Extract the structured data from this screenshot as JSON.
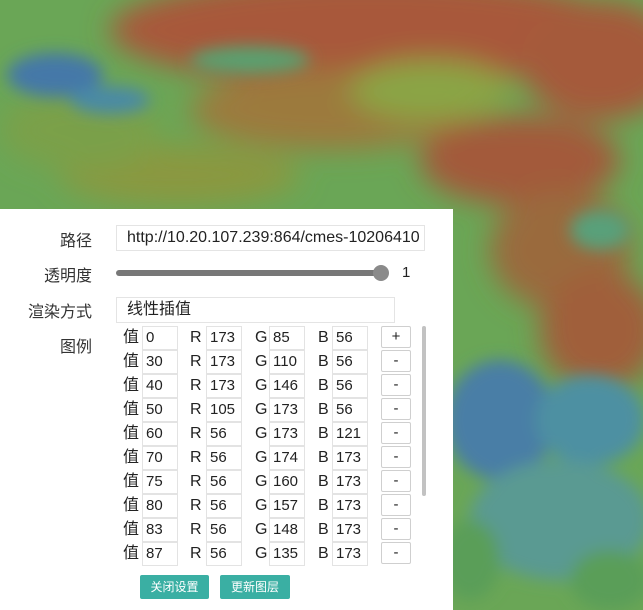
{
  "panel": {
    "path_label": "路径",
    "path_value": "http://10.20.107.239:864/cmes-10206410",
    "opacity_label": "透明度",
    "opacity_value": "1",
    "render_label": "渲染方式",
    "render_value": "线性插值",
    "legend_label": "图例",
    "legend": {
      "value_caption": "值",
      "r_caption": "R",
      "g_caption": "G",
      "b_caption": "B",
      "rows": [
        {
          "v": "0",
          "r": "173",
          "g": "85",
          "b": "56",
          "btn": "+"
        },
        {
          "v": "30",
          "r": "173",
          "g": "110",
          "b": "56",
          "btn": "-"
        },
        {
          "v": "40",
          "r": "173",
          "g": "146",
          "b": "56",
          "btn": "-"
        },
        {
          "v": "50",
          "r": "105",
          "g": "173",
          "b": "56",
          "btn": "-"
        },
        {
          "v": "60",
          "r": "56",
          "g": "173",
          "b": "121",
          "btn": "-"
        },
        {
          "v": "70",
          "r": "56",
          "g": "174",
          "b": "173",
          "btn": "-"
        },
        {
          "v": "75",
          "r": "56",
          "g": "160",
          "b": "173",
          "btn": "-"
        },
        {
          "v": "80",
          "r": "56",
          "g": "157",
          "b": "173",
          "btn": "-"
        },
        {
          "v": "83",
          "r": "56",
          "g": "148",
          "b": "173",
          "btn": "-"
        },
        {
          "v": "87",
          "r": "56",
          "g": "135",
          "b": "173",
          "btn": "-"
        }
      ]
    },
    "close_button": "关闭设置",
    "update_button": "更新图层"
  },
  "colors": {
    "button_teal": "#3aafa3",
    "map_orange": "#a8583a",
    "map_green": "#5a9e58",
    "map_blue": "#4478a8"
  }
}
